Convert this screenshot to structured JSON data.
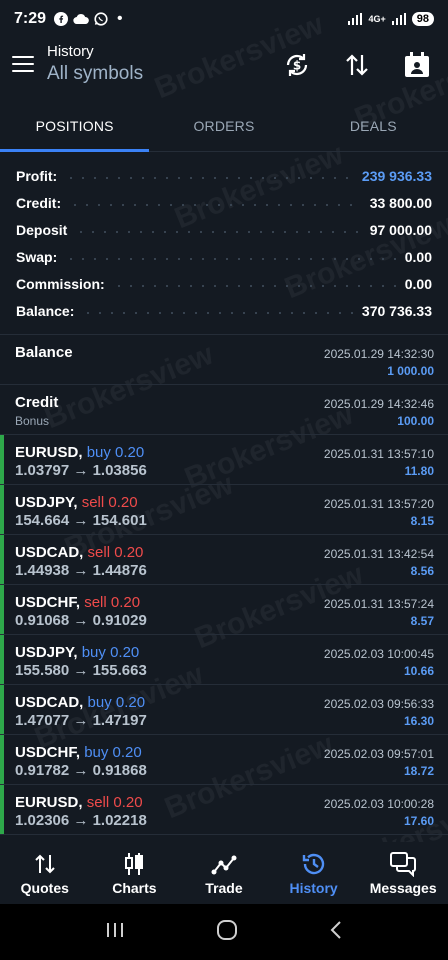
{
  "status_bar": {
    "time": "7:29",
    "battery": "98",
    "network": "4G+"
  },
  "header": {
    "title": "History",
    "subtitle": "All symbols"
  },
  "tabs": [
    {
      "label": "POSITIONS",
      "active": true
    },
    {
      "label": "ORDERS",
      "active": false
    },
    {
      "label": "DEALS",
      "active": false
    }
  ],
  "summary": [
    {
      "label": "Profit:",
      "value": "239 936.33",
      "highlight": true
    },
    {
      "label": "Credit:",
      "value": "33 800.00",
      "highlight": false
    },
    {
      "label": "Deposit",
      "value": "97 000.00",
      "highlight": false
    },
    {
      "label": "Swap:",
      "value": "0.00",
      "highlight": false
    },
    {
      "label": "Commission:",
      "value": "0.00",
      "highlight": false
    },
    {
      "label": "Balance:",
      "value": "370 736.33",
      "highlight": false
    }
  ],
  "history": [
    {
      "title": "Balance",
      "sub": "",
      "side": "",
      "volume": "",
      "open": "",
      "close": "",
      "time": "2025.01.29 14:32:30",
      "amount": "1 000.00"
    },
    {
      "title": "Credit",
      "sub": "Bonus",
      "side": "",
      "volume": "",
      "open": "",
      "close": "",
      "time": "2025.01.29 14:32:46",
      "amount": "100.00"
    },
    {
      "title": "EURUSD,",
      "side": "buy",
      "volume": "0.20",
      "open": "1.03797",
      "close": "1.03856",
      "time": "2025.01.31 13:57:10",
      "amount": "11.80"
    },
    {
      "title": "USDJPY,",
      "side": "sell",
      "volume": "0.20",
      "open": "154.664",
      "close": "154.601",
      "time": "2025.01.31 13:57:20",
      "amount": "8.15"
    },
    {
      "title": "USDCAD,",
      "side": "sell",
      "volume": "0.20",
      "open": "1.44938",
      "close": "1.44876",
      "time": "2025.01.31 13:42:54",
      "amount": "8.56"
    },
    {
      "title": "USDCHF,",
      "side": "sell",
      "volume": "0.20",
      "open": "0.91068",
      "close": "0.91029",
      "time": "2025.01.31 13:57:24",
      "amount": "8.57"
    },
    {
      "title": "USDJPY,",
      "side": "buy",
      "volume": "0.20",
      "open": "155.580",
      "close": "155.663",
      "time": "2025.02.03 10:00:45",
      "amount": "10.66"
    },
    {
      "title": "USDCAD,",
      "side": "buy",
      "volume": "0.20",
      "open": "1.47077",
      "close": "1.47197",
      "time": "2025.02.03 09:56:33",
      "amount": "16.30"
    },
    {
      "title": "USDCHF,",
      "side": "buy",
      "volume": "0.20",
      "open": "0.91782",
      "close": "0.91868",
      "time": "2025.02.03 09:57:01",
      "amount": "18.72"
    },
    {
      "title": "EURUSD,",
      "side": "sell",
      "volume": "0.20",
      "open": "1.02306",
      "close": "1.02218",
      "time": "2025.02.03 10:00:28",
      "amount": "17.60"
    }
  ],
  "arrow": "→",
  "bottom_nav": [
    {
      "label": "Quotes",
      "icon": "quotes-icon",
      "active": false
    },
    {
      "label": "Charts",
      "icon": "charts-icon",
      "active": false
    },
    {
      "label": "Trade",
      "icon": "trade-icon",
      "active": false
    },
    {
      "label": "History",
      "icon": "history-icon",
      "active": true
    },
    {
      "label": "Messages",
      "icon": "messages-icon",
      "active": false
    }
  ],
  "watermark": "Brokersview",
  "colors": {
    "accent": "#3b82f6",
    "buy": "#4f8ff5",
    "sell": "#ef4b4b",
    "position_bar": "#2ea84a",
    "background": "#141a22"
  }
}
